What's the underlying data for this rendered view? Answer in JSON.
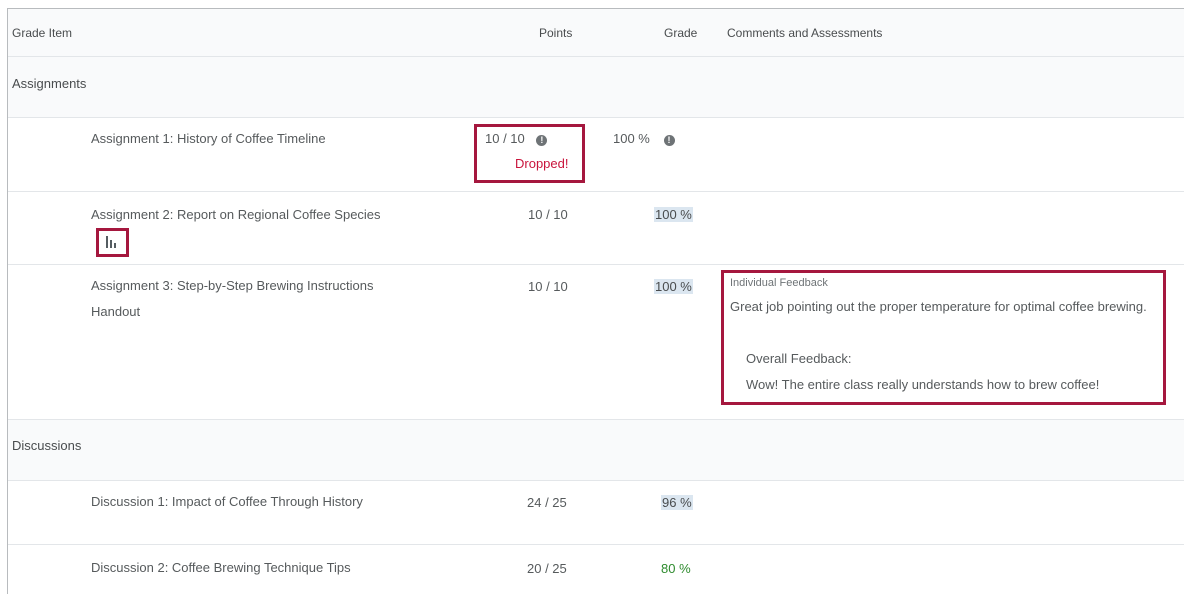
{
  "header": {
    "grade_item": "Grade Item",
    "points": "Points",
    "grade": "Grade",
    "comments": "Comments and Assessments"
  },
  "categories": [
    {
      "label": "Assignments"
    },
    {
      "label": "Discussions"
    }
  ],
  "items": [
    {
      "name": "Assignment 1: History of Coffee Timeline",
      "points": "10 / 10",
      "grade": "100 %",
      "dropped": "Dropped!"
    },
    {
      "name": "Assignment 2: Report on Regional Coffee Species",
      "points": "10 / 10",
      "grade": "100 %"
    },
    {
      "name_line1": "Assignment 3: Step-by-Step Brewing Instructions",
      "name_line2": "Handout",
      "points": "10 / 10",
      "grade": "100 %",
      "feedback": {
        "title": "Individual Feedback",
        "text": "Great job pointing out the proper temperature for optimal coffee brewing.",
        "overall_label": "Overall Feedback:",
        "overall_text": "Wow! The entire class really understands how to brew coffee!"
      }
    },
    {
      "name": "Discussion 1: Impact of Coffee Through History",
      "points": "24 / 25",
      "grade": "96 %"
    },
    {
      "name": "Discussion 2: Coffee Brewing Technique Tips",
      "points": "20 / 25",
      "grade": "80 %"
    }
  ],
  "icons": {
    "info": "info-icon",
    "stats": "statistics-icon"
  },
  "colors": {
    "highlight_box": "#a5173e",
    "dropped": "#c9143c",
    "grade_highlight": "#dbe6f0",
    "grade_green": "#2e8b2e"
  }
}
